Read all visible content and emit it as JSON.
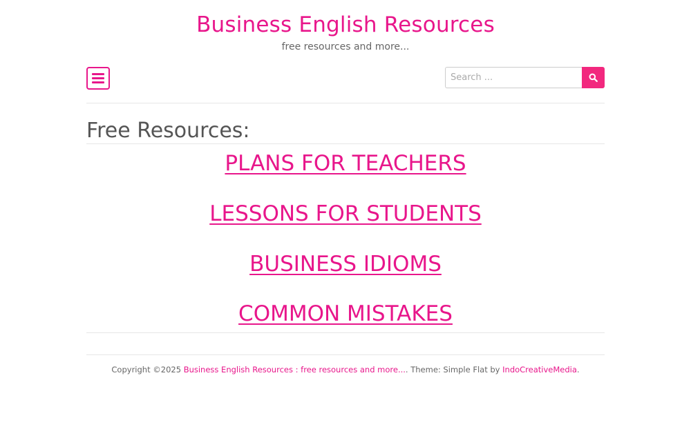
{
  "header": {
    "site_title": "Business English Resources",
    "tagline": "free resources and more..."
  },
  "toolbar": {
    "menu_icon": "hamburger-menu-icon",
    "search_placeholder": "Search ...",
    "search_icon": "search-icon"
  },
  "main": {
    "heading": "Free Resources:",
    "links": [
      {
        "label": "PLANS FOR TEACHERS"
      },
      {
        "label": "LESSONS FOR STUDENTS"
      },
      {
        "label": "BUSINESS IDIOMS"
      },
      {
        "label": "COMMON MISTAKES"
      }
    ]
  },
  "footer": {
    "copyright_prefix": "Copyright ©2025",
    "site_link": "Business English Resources : free resources and more...",
    "theme_text": ". Theme: Simple Flat by",
    "author_link": "IndoCreativeMedia",
    "end": "."
  },
  "colors": {
    "accent": "#e8168b",
    "button": "#f2287e",
    "text": "#555555",
    "divider": "#e6e6e6"
  }
}
